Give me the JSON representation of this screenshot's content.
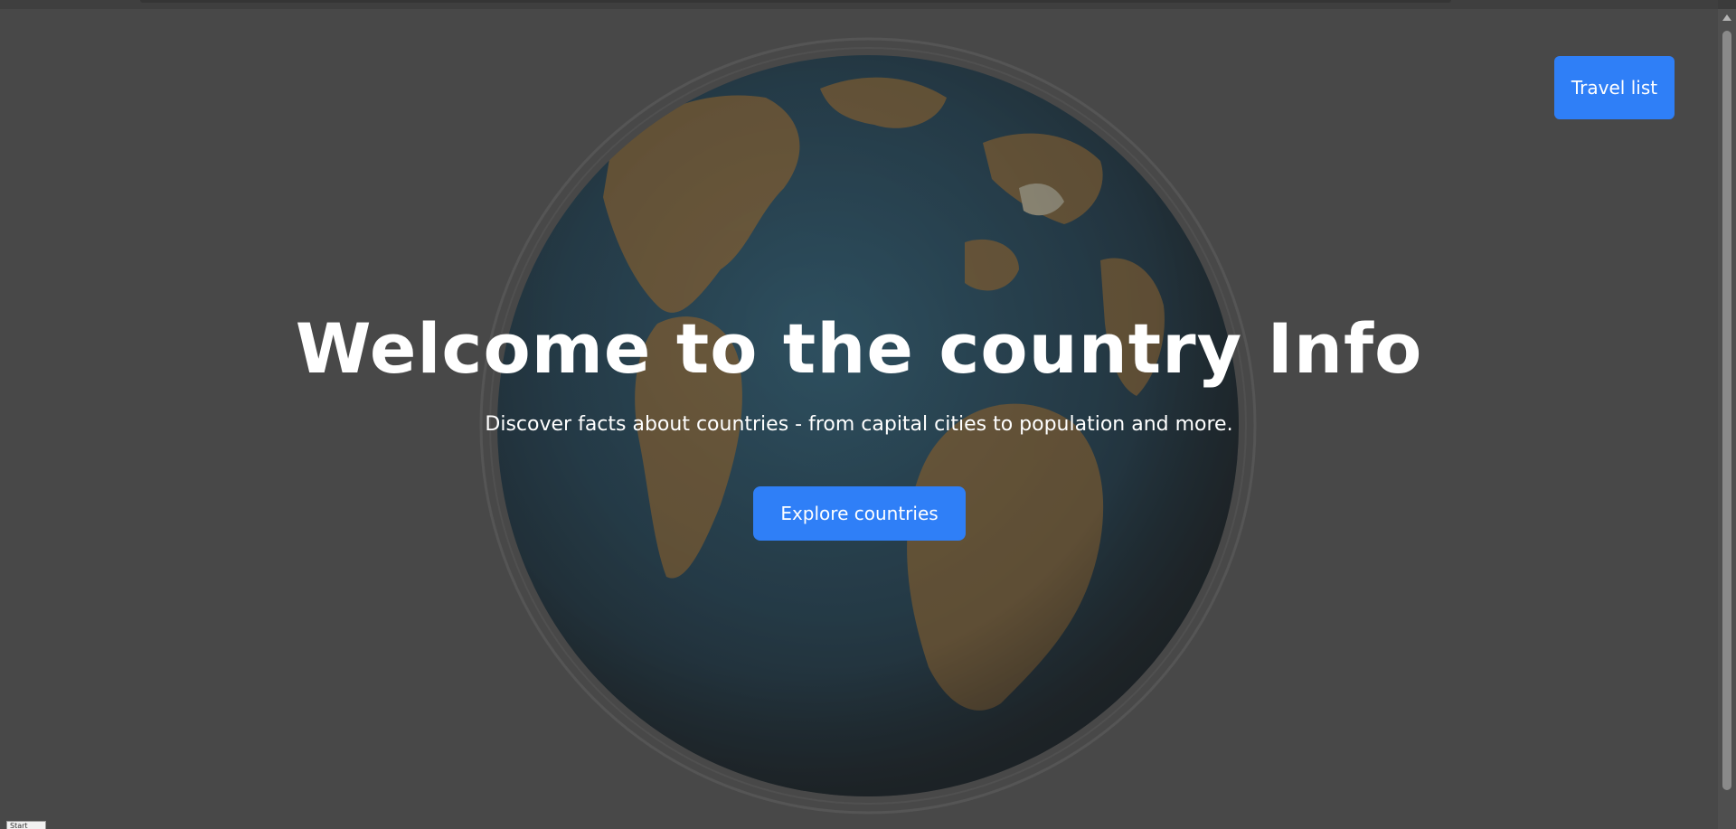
{
  "hero": {
    "title": "Welcome to the country Info",
    "subtitle": "Discover facts about countries - from capital cities to population and more.",
    "explore_label": "Explore countries"
  },
  "header": {
    "travel_list_label": "Travel list"
  },
  "background": {
    "image": "globe-image",
    "overlay_color": "#4a4a4a"
  },
  "colors": {
    "accent": "#2f7ff7",
    "text": "#ffffff",
    "background": "#4a4a4a",
    "ocean": "#0f3a52",
    "land": "#9a6a2c"
  },
  "corner_widget": {
    "label": "Start"
  }
}
